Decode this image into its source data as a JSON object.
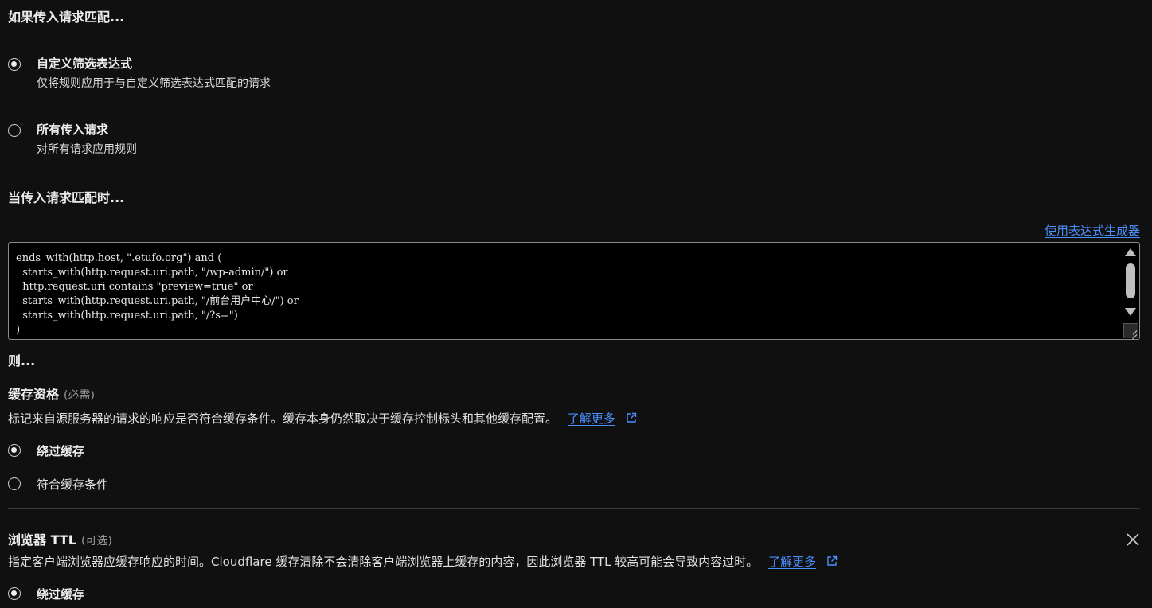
{
  "match_section": {
    "title": "如果传入请求匹配...",
    "options": [
      {
        "label": "自定义筛选表达式",
        "description": "仅将规则应用于与自定义筛选表达式匹配的请求",
        "selected": true
      },
      {
        "label": "所有传入请求",
        "description": "对所有请求应用规则",
        "selected": false
      }
    ]
  },
  "when_section": {
    "title": "当传入请求匹配时...",
    "builder_link": "使用表达式生成器",
    "expression_lines": [
      "ends_with(http.host, \".etufo.org\") and (",
      "  starts_with(http.request.uri.path, \"/wp-admin/\") or",
      "  http.request.uri contains \"preview=true\" or",
      "  starts_with(http.request.uri.path, \"/前台用户中心/\") or",
      "  starts_with(http.request.uri.path, \"/?s=\")",
      ")"
    ]
  },
  "then_section": {
    "title": "则..."
  },
  "cache_eligibility": {
    "title": "缓存资格",
    "hint": "(必需)",
    "description": "标记来自源服务器的请求的响应是否符合缓存条件。缓存本身仍然取决于缓存控制标头和其他缓存配置。",
    "learn_more": "了解更多",
    "options": [
      {
        "label": "绕过缓存",
        "selected": true
      },
      {
        "label": "符合缓存条件",
        "selected": false
      }
    ]
  },
  "browser_ttl": {
    "title": "浏览器 TTL",
    "hint": "(可选)",
    "description": "指定客户端浏览器应缓存响应的时间。Cloudflare 缓存清除不会清除客户端浏览器上缓存的内容，因此浏览器 TTL 较高可能会导致内容过时。",
    "learn_more": "了解更多",
    "options": [
      {
        "label": "绕过缓存",
        "selected": true
      }
    ]
  },
  "colors": {
    "background": "#101010",
    "editor_background": "#000000",
    "link": "#4a90ff",
    "hint": "#9a9a9a"
  }
}
